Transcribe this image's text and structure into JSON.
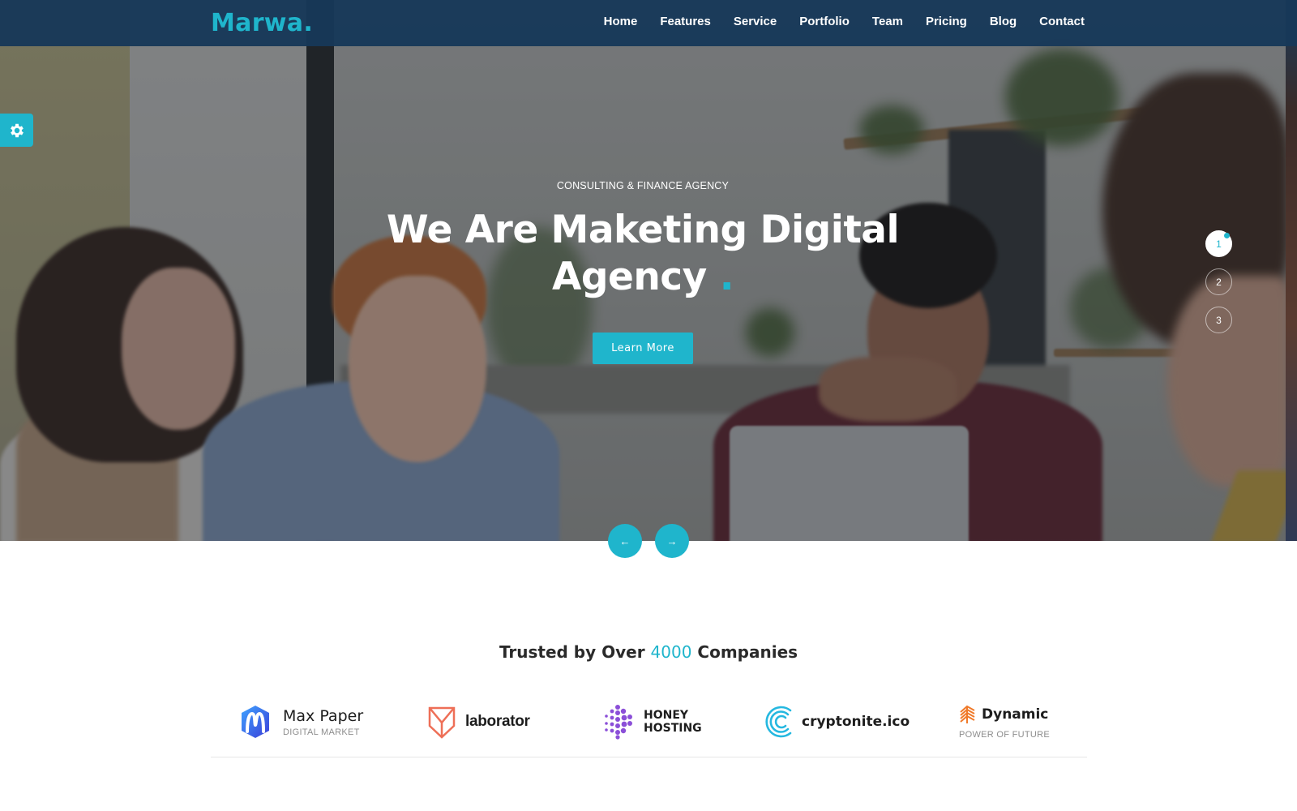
{
  "brand": {
    "logo": "Marwa.",
    "accent_color": "#1fb5cc",
    "nav_color": "#173858"
  },
  "nav": {
    "items": [
      {
        "label": "Home"
      },
      {
        "label": "Features"
      },
      {
        "label": "Service"
      },
      {
        "label": "Portfolio"
      },
      {
        "label": "Team"
      },
      {
        "label": "Pricing"
      },
      {
        "label": "Blog"
      },
      {
        "label": "Contact"
      }
    ]
  },
  "settings": {
    "icon": "gear-icon"
  },
  "hero": {
    "eyebrow": "CONSULTING & FINANCE AGENCY",
    "headline_line1": "We Are Maketing Digital",
    "headline_line2": "Agency",
    "headline_dot": ".",
    "cta_label": "Learn More",
    "slides": [
      {
        "label": "1",
        "active": true
      },
      {
        "label": "2",
        "active": false
      },
      {
        "label": "3",
        "active": false
      }
    ],
    "prev_label": "←",
    "next_label": "→"
  },
  "trusted": {
    "prefix": "Trusted by Over",
    "count": "4000",
    "suffix": "Companies",
    "logos": [
      {
        "name": "Max Paper",
        "tagline": "DIGITAL MARKET",
        "icon": "max-paper-logo-icon"
      },
      {
        "name": "laborator",
        "tagline": "",
        "icon": "laborator-logo-icon"
      },
      {
        "name": "HONEY",
        "name2": "HOSTING",
        "tagline": "",
        "icon": "honey-hosting-logo-icon"
      },
      {
        "name": "cryptonite.ico",
        "tagline": "",
        "icon": "cryptonite-logo-icon"
      },
      {
        "name": "Dynamic",
        "tagline": "POWER OF FUTURE",
        "icon": "dynamic-logo-icon"
      }
    ]
  }
}
